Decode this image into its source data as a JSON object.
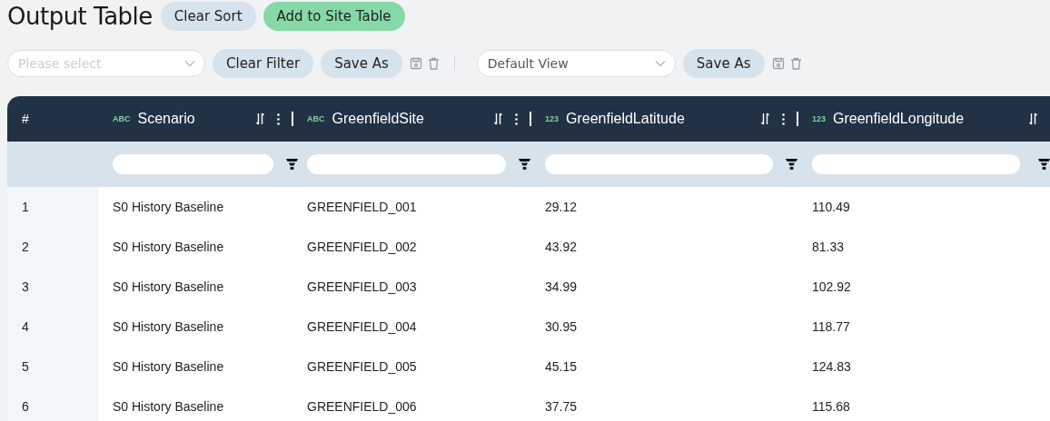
{
  "title": "Output Table",
  "header_buttons": [
    {
      "label": "Clear Sort",
      "kind": "plain"
    },
    {
      "label": "Add to Site Table",
      "kind": "primary"
    }
  ],
  "filter_bar": {
    "placeholder": "Please select",
    "buttons": [
      "Clear Filter",
      "Save As"
    ]
  },
  "view_bar": {
    "value": "Default View",
    "buttons": [
      "Save As"
    ]
  },
  "table": {
    "columns": [
      {
        "name": "#",
        "kind": "index"
      },
      {
        "name": "Scenario",
        "type": "ABC"
      },
      {
        "name": "GreenfieldSite",
        "type": "ABC"
      },
      {
        "name": "GreenfieldLatitude",
        "type": "123"
      },
      {
        "name": "GreenfieldLongitude",
        "type": "123"
      }
    ],
    "rows": [
      [
        "1",
        "S0 History Baseline",
        "GREENFIELD_001",
        "29.12",
        "110.49"
      ],
      [
        "2",
        "S0 History Baseline",
        "GREENFIELD_002",
        "43.92",
        "81.33"
      ],
      [
        "3",
        "S0 History Baseline",
        "GREENFIELD_003",
        "34.99",
        "102.92"
      ],
      [
        "4",
        "S0 History Baseline",
        "GREENFIELD_004",
        "30.95",
        "118.77"
      ],
      [
        "5",
        "S0 History Baseline",
        "GREENFIELD_005",
        "45.15",
        "124.83"
      ],
      [
        "6",
        "S0 History Baseline",
        "GREENFIELD_006",
        "37.75",
        "115.68"
      ]
    ]
  }
}
